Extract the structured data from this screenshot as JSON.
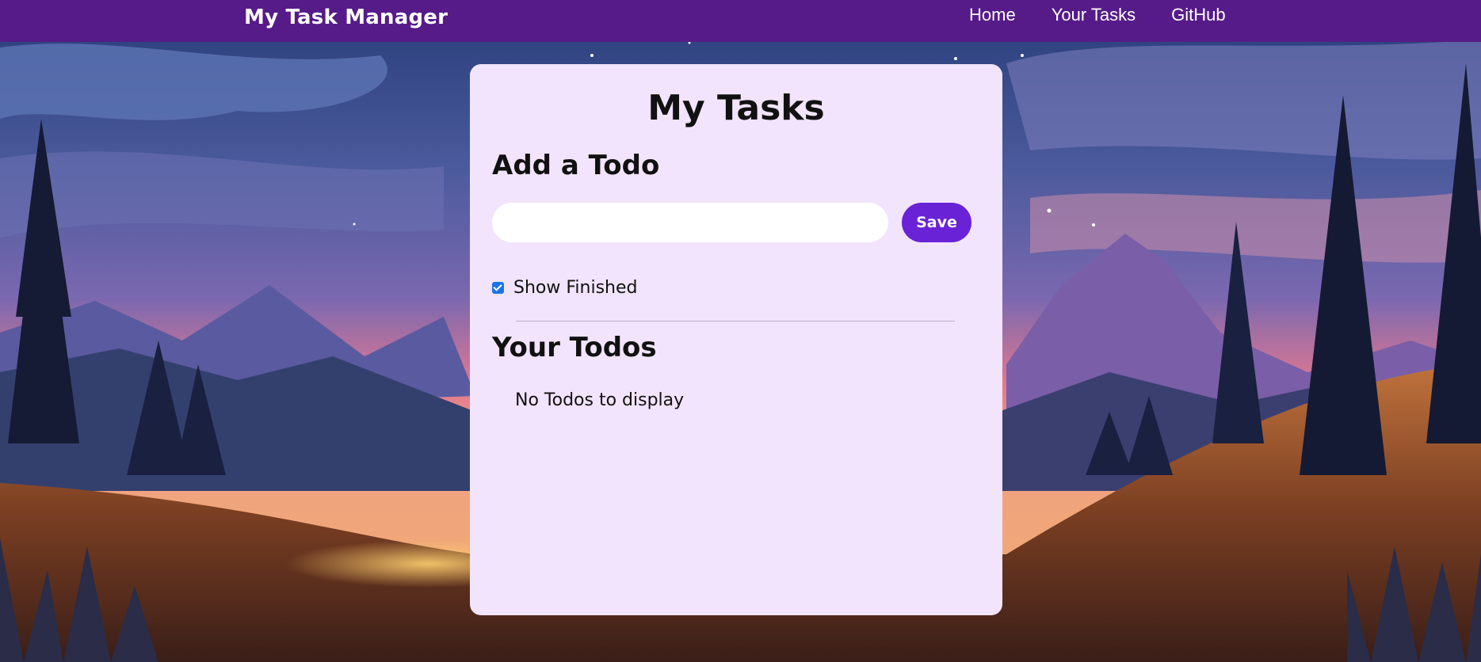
{
  "navbar": {
    "brand": "My Task Manager",
    "links": [
      {
        "label": "Home"
      },
      {
        "label": "Your Tasks"
      },
      {
        "label": "GitHub"
      }
    ]
  },
  "card": {
    "title": "My Tasks",
    "add_heading": "Add a Todo",
    "input": {
      "value": "",
      "placeholder": ""
    },
    "save_label": "Save",
    "show_finished": {
      "label": "Show Finished",
      "checked": true
    },
    "todos_heading": "Your Todos",
    "empty_message": "No Todos to display"
  },
  "colors": {
    "navbar_bg": "#561b89",
    "card_bg": "#f2e4fc",
    "button_bg": "#6a22d6",
    "checkbox": "#1a73e8"
  },
  "background": {
    "image": "mountain-landscape-illustration"
  }
}
